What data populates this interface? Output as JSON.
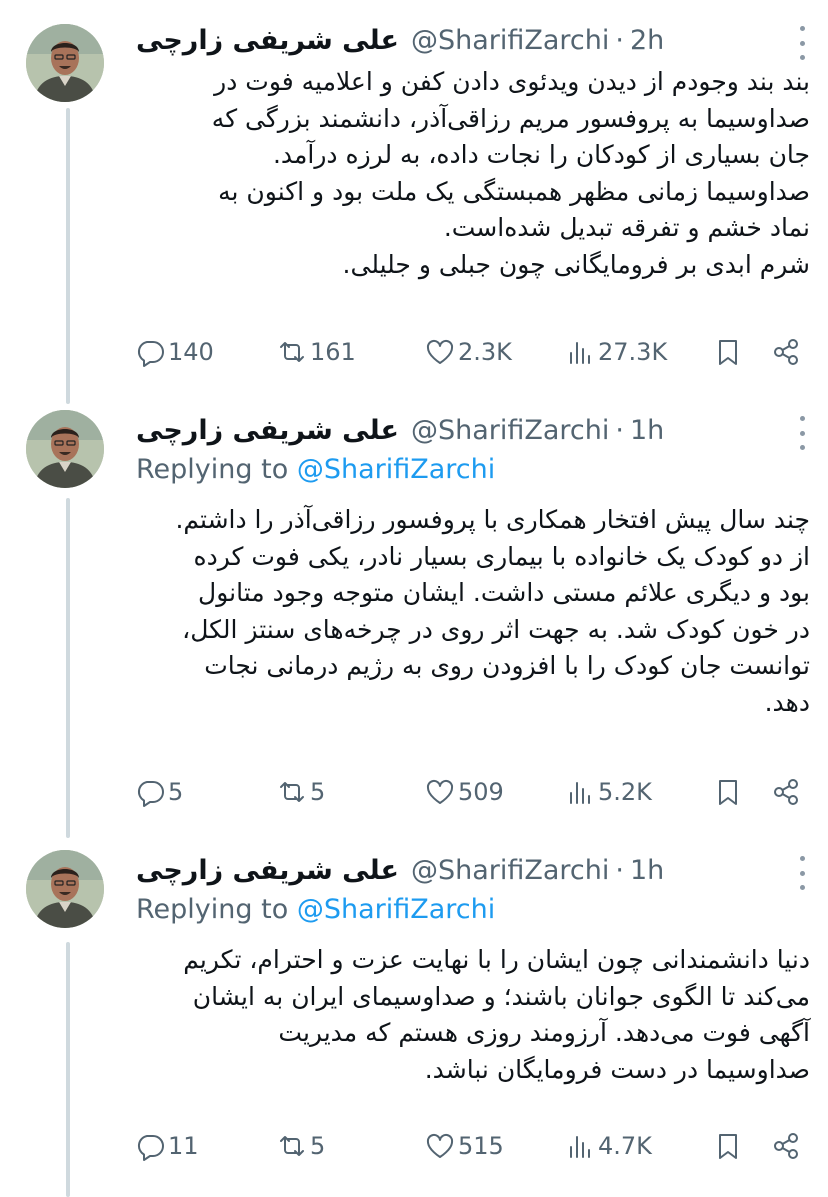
{
  "author": {
    "name": "علی شریفی زارچی",
    "handle": "@SharifiZarchi"
  },
  "tweets": [
    {
      "time": "2h",
      "replying_to_label": "",
      "replying_to_handle": "",
      "lines": [
        "بند بند وجودم از دیدن ویدئوی دادن کفن و اعلامیه فوت در",
        "صداوسیما به پروفسور مریم رزاقی‌آذر، دانشمند بزرگی که",
        "جان بسیاری از کودکان را نجات داده، به لرزه درآمد.",
        "صداوسیما زمانی مظهر همبستگی یک ملت بود و اکنون به",
        "نماد خشم و تفرقه تبدیل شده‌است.",
        "شرم ابدی بر فرومایگانی چون جبلی و جلیلی."
      ],
      "replies": "140",
      "retweets": "161",
      "likes": "2.3K",
      "views": "27.3K"
    },
    {
      "time": "1h",
      "replying_to_label": "Replying to",
      "replying_to_handle": "@SharifiZarchi",
      "lines": [
        "چند سال پیش افتخار همکاری با پروفسور رزاقی‌آذر را داشتم.",
        "از دو کودک یک خانواده با بیماری بسیار نادر، یکی فوت کرده",
        "بود و دیگری علائم مستی داشت. ایشان متوجه وجود متانول",
        "در خون کودک شد. به جهت اثر روی در چرخه‌های سنتز الکل،",
        "توانست جان کودک را با افزودن روی به رژیم درمانی نجات",
        "دهد."
      ],
      "replies": "5",
      "retweets": "5",
      "likes": "509",
      "views": "5.2K"
    },
    {
      "time": "1h",
      "replying_to_label": "Replying to",
      "replying_to_handle": "@SharifiZarchi",
      "lines": [
        "دنیا دانشمندانی چون ایشان را با نهایت عزت و احترام، تکریم",
        "می‌کند تا الگوی جوانان باشند؛ و صداوسیمای ایران به ایشان",
        "آگهی فوت می‌دهد. آرزومند روزی هستم که مدیریت",
        "صداوسیما در دست فرومایگان نباشد."
      ],
      "replies": "11",
      "retweets": "5",
      "likes": "515",
      "views": "4.7K"
    }
  ],
  "icons": {
    "reply": "reply-icon",
    "retweet": "retweet-icon",
    "like": "heart-icon",
    "views": "views-icon",
    "bookmark": "bookmark-icon",
    "share": "share-icon",
    "more": "more-options-icon"
  },
  "colors": {
    "text": "#0f1419",
    "secondary": "#536471",
    "link": "#1d9bf0",
    "thread_line": "#cfd9de"
  }
}
